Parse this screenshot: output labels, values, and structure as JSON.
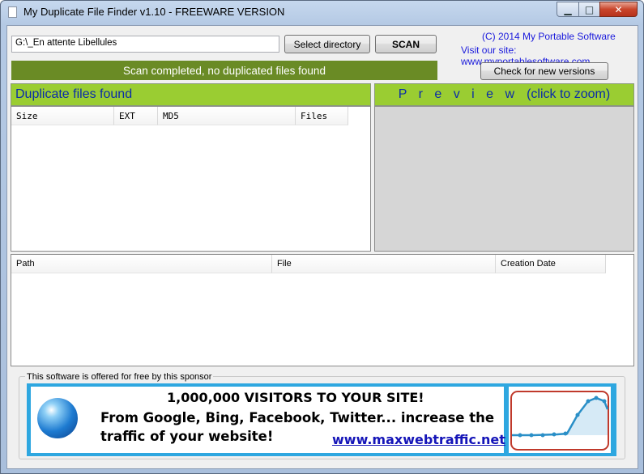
{
  "window": {
    "title": "My Duplicate File Finder v1.10 - FREEWARE VERSION",
    "controls": {
      "minimize": "▁",
      "maximize": "□",
      "close": "✕"
    }
  },
  "toolbar": {
    "directory_value": "G:\\_En attente Libellules",
    "select_directory_label": "Select directory",
    "scan_label": "SCAN",
    "copyright": "(C) 2014 My Portable Software",
    "visit": "Visit our site: www.myportablesoftware.com",
    "check_versions_label": "Check for new versions"
  },
  "status": {
    "message": "Scan completed, no duplicated files found",
    "color": "#6a8b25"
  },
  "duplicates_panel": {
    "title": "Duplicate files found",
    "columns": [
      "Size",
      "EXT",
      "MD5",
      "Files"
    ],
    "rows": []
  },
  "preview_panel": {
    "title_spaced": "P r e v i e w",
    "title_hint": "(click to zoom)"
  },
  "files_panel": {
    "columns": [
      "Path",
      "File",
      "Creation Date"
    ],
    "rows": []
  },
  "sponsor": {
    "label": "This software is offered for free by this sponsor",
    "headline": "1,000,000 VISITORS TO YOUR SITE!",
    "body_line1": "From Google, Bing, Facebook, Twitter... increase the",
    "body_line2": "traffic of your website!",
    "link": "www.maxwebtraffic.net"
  },
  "colors": {
    "panel_header": "#9acd32",
    "panel_header_text": "#0a2ca8",
    "link_blue": "#1a1adc",
    "banner_border": "#2ea7e0"
  }
}
